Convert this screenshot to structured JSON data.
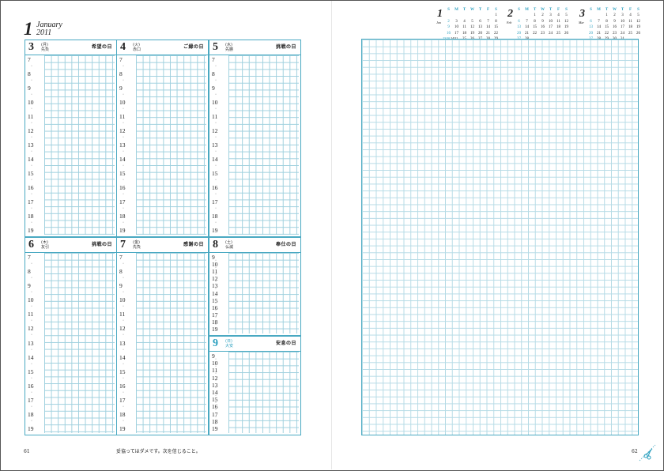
{
  "month": {
    "number": "1",
    "name": "January",
    "year": "2011"
  },
  "hours": [
    "7",
    "8",
    "9",
    "10",
    "11",
    "12",
    "13",
    "14",
    "15",
    "16",
    "17",
    "18",
    "19"
  ],
  "weekend_hours": [
    "9",
    "10",
    "11",
    "12",
    "13",
    "14",
    "15",
    "16",
    "17",
    "18",
    "19"
  ],
  "weekend_hours_short": [
    "9",
    "10",
    "11",
    "12",
    "13",
    "14",
    "15",
    "16",
    "17",
    "18",
    "19"
  ],
  "days": [
    {
      "num": "3",
      "weekday": "(月)",
      "rokuyo": "先負",
      "title": "希望の日"
    },
    {
      "num": "4",
      "weekday": "(火)",
      "rokuyo": "赤口",
      "title": "ご縁の日"
    },
    {
      "num": "5",
      "weekday": "(水)",
      "rokuyo": "先勝",
      "title": "挑戦の日"
    },
    {
      "num": "6",
      "weekday": "(木)",
      "rokuyo": "友引",
      "title": "挑戦の日"
    },
    {
      "num": "7",
      "weekday": "(金)",
      "rokuyo": "先負",
      "title": "感謝の日"
    },
    {
      "num": "8",
      "weekday": "(土)",
      "rokuyo": "仏滅",
      "title": "奉仕の日"
    },
    {
      "num": "9",
      "weekday": "(日)",
      "rokuyo": "大安",
      "title": "安息の日"
    }
  ],
  "footer": {
    "page_left": "61",
    "page_right": "62",
    "motto": "妥協ってはダメです。次を信じること。"
  },
  "mini_calendars": [
    {
      "num": "1",
      "abbr": "Jan",
      "weekdays": [
        "S",
        "M",
        "T",
        "W",
        "T",
        "F",
        "S"
      ],
      "weeks": [
        [
          "",
          "",
          "",
          "",
          "",
          "",
          "1"
        ],
        [
          "2",
          "3",
          "4",
          "5",
          "6",
          "7",
          "8"
        ],
        [
          "9",
          "10",
          "11",
          "12",
          "13",
          "14",
          "15"
        ],
        [
          "16",
          "17",
          "18",
          "19",
          "20",
          "21",
          "22"
        ],
        [
          "23/30",
          "24/31",
          "25",
          "26",
          "27",
          "28",
          "29"
        ]
      ]
    },
    {
      "num": "2",
      "abbr": "Feb",
      "weekdays": [
        "S",
        "M",
        "T",
        "W",
        "T",
        "F",
        "S"
      ],
      "weeks": [
        [
          "",
          "",
          "1",
          "2",
          "3",
          "4",
          "5"
        ],
        [
          "6",
          "7",
          "8",
          "9",
          "10",
          "11",
          "12"
        ],
        [
          "13",
          "14",
          "15",
          "16",
          "17",
          "18",
          "19"
        ],
        [
          "20",
          "21",
          "22",
          "23",
          "24",
          "25",
          "26"
        ],
        [
          "27",
          "28",
          "",
          "",
          "",
          "",
          ""
        ]
      ]
    },
    {
      "num": "3",
      "abbr": "Mar",
      "weekdays": [
        "S",
        "M",
        "T",
        "W",
        "T",
        "F",
        "S"
      ],
      "weeks": [
        [
          "",
          "",
          "1",
          "2",
          "3",
          "4",
          "5"
        ],
        [
          "6",
          "7",
          "8",
          "9",
          "10",
          "11",
          "12"
        ],
        [
          "13",
          "14",
          "15",
          "16",
          "17",
          "18",
          "19"
        ],
        [
          "20",
          "21",
          "22",
          "23",
          "24",
          "25",
          "26"
        ],
        [
          "27",
          "28",
          "29",
          "30",
          "31",
          "",
          ""
        ]
      ]
    }
  ],
  "colors": {
    "accent": "#2a9fbf",
    "grid_line": "#9fd0de",
    "border": "#4aa9c2"
  }
}
